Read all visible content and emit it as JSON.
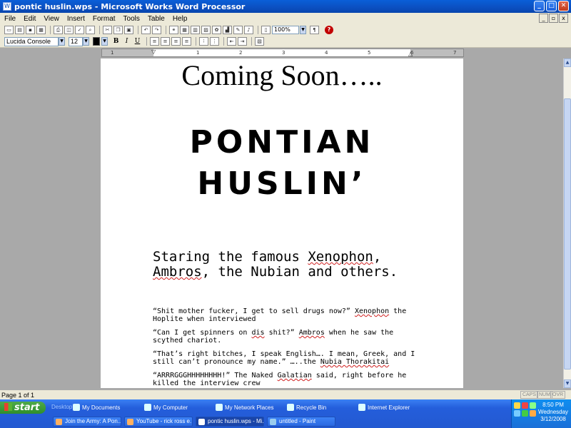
{
  "window": {
    "title": "pontic huslin.wps - Microsoft Works Word Processor"
  },
  "menu": [
    "File",
    "Edit",
    "View",
    "Insert",
    "Format",
    "Tools",
    "Table",
    "Help"
  ],
  "toolbar": {
    "zoom": "100%",
    "pilcrow": "¶",
    "help": "?"
  },
  "format": {
    "font": "Lucida Console",
    "size": "12",
    "bold": "B",
    "italic": "I",
    "underline": "U"
  },
  "ruler": [
    "1",
    "1",
    "2",
    "3",
    "4",
    "5",
    "6",
    "7"
  ],
  "document": {
    "heading": "Coming Soon…..",
    "logo_line1": "PONTIAN",
    "logo_line2": "HUSLIN’",
    "starring": {
      "pre": "Staring the famous ",
      "xeno": "Xenophon",
      "comma": ",",
      "ambros": "Ambros",
      "post": ", the Nubian and others."
    },
    "quotes": [
      {
        "a": "“Shit mother fucker, I get to sell drugs now?” ",
        "sp": "Xenophon",
        "b": " the Hoplite when interviewed"
      },
      {
        "a": "“Can I get spinners on ",
        "sp": "dis",
        "b": " shit?” ",
        "sp2": "Ambros",
        "c": " when he saw the scythed chariot."
      },
      {
        "a": "“That’s right bitches, I speak English…. I mean, Greek, and I still can’t pronounce my name.” …..the ",
        "sp": "Nubia Thorakitai"
      },
      {
        "a": "“ARRRGGGHHHHHHHH!” The Naked ",
        "sp": "Galatian",
        "b": " said, right before he killed the interview crew"
      }
    ]
  },
  "status": {
    "page": "Page 1 of 1",
    "caps": "CAPS",
    "num": "NUM",
    "ovr": "OVR"
  },
  "taskbar": {
    "start": "start",
    "quicklaunch": [
      "Desktop",
      "My Documents",
      "My Computer",
      "My Network Places",
      "Recycle Bin",
      "Internet Explorer"
    ],
    "buttons": [
      "Join the Army: A Pon...",
      "YouTube - rick ross e...",
      "pontic huslin.wps - Mi...",
      "untitled - Paint"
    ],
    "time": "8:50 PM",
    "day": "Wednesday",
    "date": "3/12/2008"
  }
}
